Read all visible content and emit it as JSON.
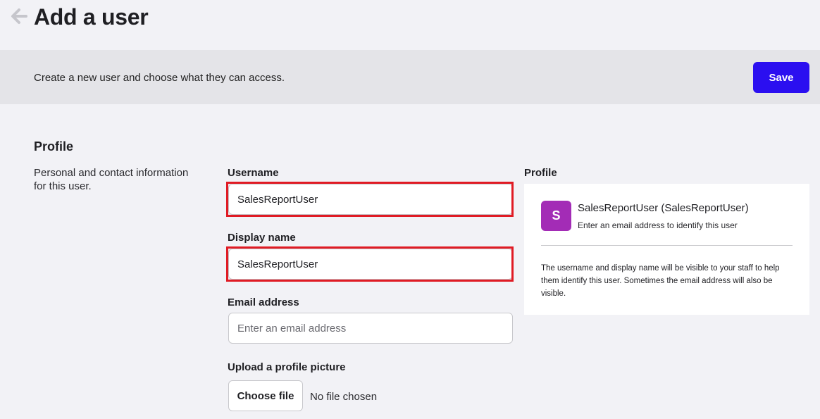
{
  "header": {
    "back_icon": "arrow-left-icon",
    "title": "Add a user"
  },
  "banner": {
    "description": "Create a new user and choose what they can access.",
    "save_label": "Save",
    "accent_color": "#2b0ff0"
  },
  "profile_section": {
    "title": "Profile",
    "description": "Personal and contact information for this user."
  },
  "form": {
    "username": {
      "label": "Username",
      "value": "SalesReportUser"
    },
    "display_name": {
      "label": "Display name",
      "value": "SalesReportUser"
    },
    "email": {
      "label": "Email address",
      "value": "",
      "placeholder": "Enter an email address"
    },
    "picture": {
      "label": "Upload a profile picture",
      "button_label": "Choose file",
      "status": "No file chosen"
    },
    "highlight_color": "#e01b24"
  },
  "preview": {
    "label": "Profile",
    "avatar_initial": "S",
    "avatar_color": "#a32cb6",
    "name": "SalesReportUser (SalesReportUser)",
    "email_hint": "Enter an email address to identify this user",
    "note": "The username and display name will be visible to your staff to help them identify this user. Sometimes the email address will also be visible."
  }
}
